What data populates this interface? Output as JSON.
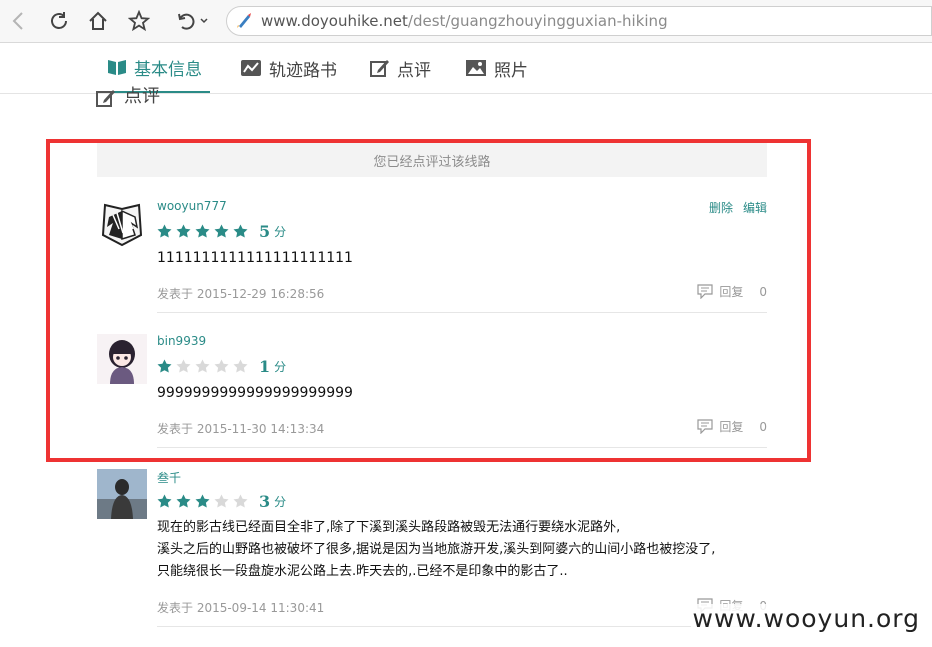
{
  "browser": {
    "url_domain": "www.doyouhike.net",
    "url_path": "/dest/guangzhouyingguxian-hiking"
  },
  "tabs": [
    {
      "label": "基本信息",
      "icon": "book-icon",
      "active": true
    },
    {
      "label": "轨迹路书",
      "icon": "track-chart-icon",
      "active": false
    },
    {
      "label": "点评",
      "icon": "edit-icon",
      "active": false
    },
    {
      "label": "照片",
      "icon": "photo-icon",
      "active": false
    }
  ],
  "section_heading": "点评",
  "notice": "您已经点评过该线路",
  "labels": {
    "delete": "删除",
    "edit": "编辑",
    "reply": "回复",
    "score_unit": "分"
  },
  "comments": [
    {
      "user": "wooyun777",
      "rating": 5,
      "text": [
        "1111111111111111111111"
      ],
      "posted": "发表于  2015-12-29 16:28:56",
      "reply_count": "0",
      "own": true
    },
    {
      "user": "bin9939",
      "rating": 1,
      "text": [
        "9999999999999999999999"
      ],
      "posted": "发表于  2015-11-30 14:13:34",
      "reply_count": "0",
      "own": false
    },
    {
      "user": "叁千",
      "rating": 3,
      "text": [
        "现在的影古线已经面目全非了,除了下溪到溪头路段路被毁无法通行要绕水泥路外,",
        "溪头之后的山野路也被破坏了很多,据说是因为当地旅游开发,溪头到阿婆六的山间小路也被挖没了,",
        "只能绕很长一段盘旋水泥公路上去.昨天去的,.已经不是印象中的影古了.."
      ],
      "posted": "发表于  2015-09-14 11:30:41",
      "reply_count": "0",
      "own": false
    }
  ],
  "watermark": "www.wooyun.org",
  "colors": {
    "accent": "#2a8b87",
    "highlight": "#ee3333",
    "star_empty": "#d9d9d9"
  }
}
